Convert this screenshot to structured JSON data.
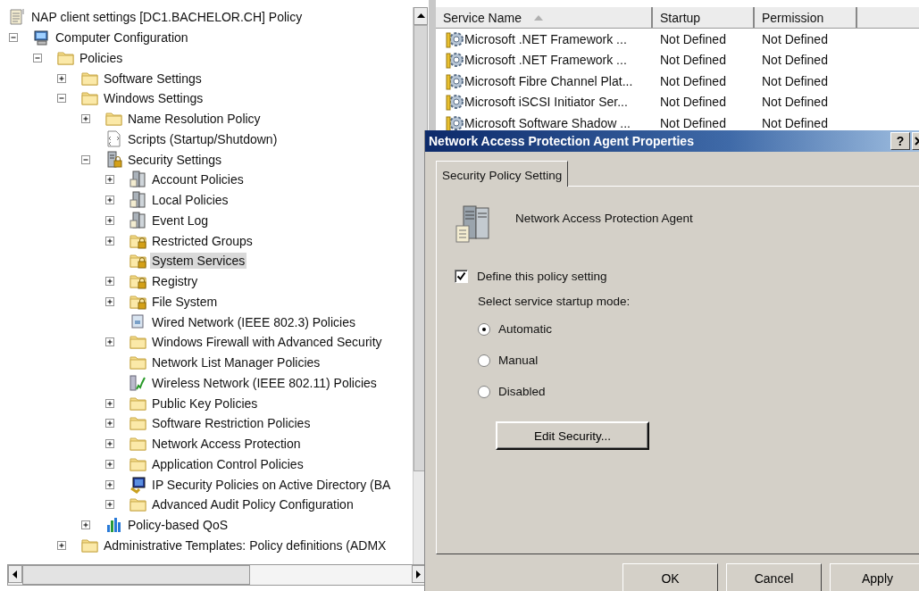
{
  "tree": {
    "title": "NAP client settings [DC1.BACHELOR.CH] Policy",
    "items": [
      {
        "label": "Computer Configuration",
        "kind": "computer",
        "expanded": true,
        "selected": false,
        "children": [
          {
            "label": "Policies",
            "kind": "folder",
            "expanded": true,
            "selected": false,
            "children": [
              {
                "label": "Software Settings",
                "kind": "folder",
                "expanded": false,
                "selected": false
              },
              {
                "label": "Windows Settings",
                "kind": "folder",
                "expanded": true,
                "selected": false,
                "children": [
                  {
                    "label": "Name Resolution Policy",
                    "kind": "folder",
                    "expanded": false,
                    "selected": false
                  },
                  {
                    "label": "Scripts (Startup/Shutdown)",
                    "kind": "script",
                    "selected": false
                  },
                  {
                    "label": "Security Settings",
                    "kind": "security",
                    "expanded": true,
                    "selected": false,
                    "children": [
                      {
                        "label": "Account Policies",
                        "kind": "server",
                        "expanded": false,
                        "selected": false
                      },
                      {
                        "label": "Local Policies",
                        "kind": "server",
                        "expanded": false,
                        "selected": false
                      },
                      {
                        "label": "Event Log",
                        "kind": "server",
                        "expanded": false,
                        "selected": false
                      },
                      {
                        "label": "Restricted Groups",
                        "kind": "locked-folder",
                        "expanded": false,
                        "selected": false
                      },
                      {
                        "label": "System Services",
                        "kind": "locked-folder",
                        "selected": true
                      },
                      {
                        "label": "Registry",
                        "kind": "locked-folder",
                        "expanded": false,
                        "selected": false
                      },
                      {
                        "label": "File System",
                        "kind": "locked-folder",
                        "expanded": false,
                        "selected": false
                      },
                      {
                        "label": "Wired Network (IEEE 802.3) Policies",
                        "kind": "network",
                        "selected": false
                      },
                      {
                        "label": "Windows Firewall with Advanced Security",
                        "kind": "folder",
                        "expanded": false,
                        "selected": false
                      },
                      {
                        "label": "Network List Manager Policies",
                        "kind": "folder",
                        "selected": false
                      },
                      {
                        "label": "Wireless Network (IEEE 802.11) Policies",
                        "kind": "wireless",
                        "selected": false
                      },
                      {
                        "label": "Public Key Policies",
                        "kind": "folder",
                        "expanded": false,
                        "selected": false
                      },
                      {
                        "label": "Software Restriction Policies",
                        "kind": "folder",
                        "expanded": false,
                        "selected": false
                      },
                      {
                        "label": "Network Access Protection",
                        "kind": "folder",
                        "expanded": false,
                        "selected": false
                      },
                      {
                        "label": "Application Control Policies",
                        "kind": "folder",
                        "expanded": false,
                        "selected": false
                      },
                      {
                        "label": "IP Security Policies on Active Directory (BA",
                        "kind": "ipsec",
                        "expanded": false,
                        "selected": false
                      },
                      {
                        "label": "Advanced Audit Policy Configuration",
                        "kind": "folder",
                        "expanded": false,
                        "selected": false
                      }
                    ]
                  },
                  {
                    "label": "Policy-based QoS",
                    "kind": "chart",
                    "expanded": false,
                    "selected": false
                  }
                ]
              },
              {
                "label": "Administrative Templates: Policy definitions (ADMX",
                "kind": "folder",
                "expanded": false,
                "selected": false
              }
            ]
          }
        ]
      }
    ]
  },
  "list": {
    "columns": [
      {
        "label": "Service Name",
        "sorted": true
      },
      {
        "label": "Startup",
        "sorted": false
      },
      {
        "label": "Permission",
        "sorted": false
      }
    ],
    "rows": [
      {
        "name": "Microsoft .NET Framework ...",
        "startup": "Not Defined",
        "permission": "Not Defined"
      },
      {
        "name": "Microsoft .NET Framework ...",
        "startup": "Not Defined",
        "permission": "Not Defined"
      },
      {
        "name": "Microsoft Fibre Channel Plat...",
        "startup": "Not Defined",
        "permission": "Not Defined"
      },
      {
        "name": "Microsoft iSCSI Initiator Ser...",
        "startup": "Not Defined",
        "permission": "Not Defined"
      },
      {
        "name": "Microsoft Software Shadow ...",
        "startup": "Not Defined",
        "permission": "Not Defined"
      }
    ]
  },
  "dialog": {
    "title": "Network Access Protection Agent Properties",
    "help_button": "?",
    "tabs": [
      {
        "label": "Security Policy Setting",
        "selected": true
      }
    ],
    "service_name": "Network Access Protection Agent",
    "define_checkbox": {
      "label": "Define this policy setting",
      "checked": true
    },
    "mode_label": "Select service startup mode:",
    "modes": [
      {
        "label": "Automatic",
        "selected": true
      },
      {
        "label": "Manual",
        "selected": false
      },
      {
        "label": "Disabled",
        "selected": false
      }
    ],
    "edit_button": "Edit Security...",
    "buttons": [
      "OK",
      "Cancel",
      "Apply"
    ]
  }
}
